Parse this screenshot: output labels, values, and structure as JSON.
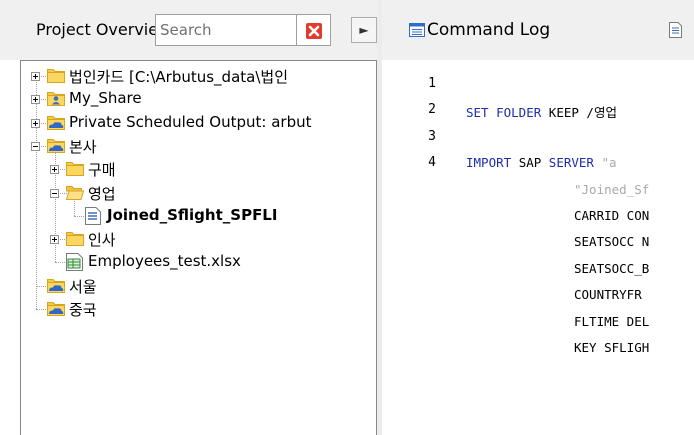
{
  "left_panel": {
    "title": "Project Overview",
    "search": {
      "placeholder": "Search",
      "value": ""
    },
    "clear_icon": "red-x-icon",
    "next_icon": "chevron-right-icon",
    "tree": [
      {
        "label": "법인카드 [C:\\Arbutus_data\\법인",
        "icon": "folder-icon",
        "level": 0,
        "expander": "plus"
      },
      {
        "label": "My_Share",
        "icon": "user-folder-icon",
        "level": 0,
        "expander": "plus"
      },
      {
        "label": "Private Scheduled Output:  arbut",
        "icon": "cloud-folder-icon",
        "level": 0,
        "expander": "plus"
      },
      {
        "label": "본사",
        "icon": "cloud-folder-icon",
        "level": 0,
        "expander": "minus"
      },
      {
        "label": "구매",
        "icon": "folder-icon",
        "level": 1,
        "expander": "plus"
      },
      {
        "label": "영업",
        "icon": "folder-open-icon",
        "level": 1,
        "expander": "minus"
      },
      {
        "label": "Joined_Sflight_SPFLI",
        "icon": "table-document-icon",
        "level": 2,
        "expander": "none",
        "bold": true
      },
      {
        "label": "인사",
        "icon": "folder-icon",
        "level": 1,
        "expander": "plus"
      },
      {
        "label": "Employees_test.xlsx",
        "icon": "excel-file-icon",
        "level": 1,
        "expander": "none"
      },
      {
        "label": "서울",
        "icon": "cloud-folder-icon",
        "level": 0,
        "expander": "none"
      },
      {
        "label": "중국",
        "icon": "cloud-folder-icon",
        "level": 0,
        "expander": "none"
      }
    ]
  },
  "tabs": [
    {
      "label": "Command Log",
      "icon": "list-icon"
    },
    {
      "label": "",
      "icon": "document-icon"
    }
  ],
  "editor": {
    "line_numbers": [
      "1",
      "2",
      "3",
      "4"
    ],
    "lines": [
      {
        "parts": []
      },
      {
        "parts": [
          {
            "t": "SET ",
            "c": "kw"
          },
          {
            "t": "FOLDER ",
            "c": "kw"
          },
          {
            "t": "KEEP /영업",
            "c": ""
          }
        ]
      },
      {
        "parts": []
      },
      {
        "parts": [
          {
            "t": "IMPORT ",
            "c": "kw"
          },
          {
            "t": "SAP ",
            "c": ""
          },
          {
            "t": "SERVER ",
            "c": "kw"
          },
          {
            "t": "\"a",
            "c": "str"
          }
        ]
      },
      {
        "parts": [
          {
            "t": "\"Joined_Sf",
            "c": "str"
          }
        ]
      },
      {
        "parts": [
          {
            "t": "CARRID CON",
            "c": ""
          }
        ]
      },
      {
        "parts": [
          {
            "t": "SEATSOCC N",
            "c": ""
          }
        ]
      },
      {
        "parts": [
          {
            "t": "SEATSOCC_B",
            "c": ""
          }
        ]
      },
      {
        "parts": [
          {
            "t": "COUNTRYFR",
            "c": ""
          }
        ]
      },
      {
        "parts": [
          {
            "t": "FLTIME DEL",
            "c": ""
          }
        ]
      },
      {
        "parts": [
          {
            "t": "KEY SFLIGH",
            "c": ""
          }
        ]
      }
    ]
  }
}
